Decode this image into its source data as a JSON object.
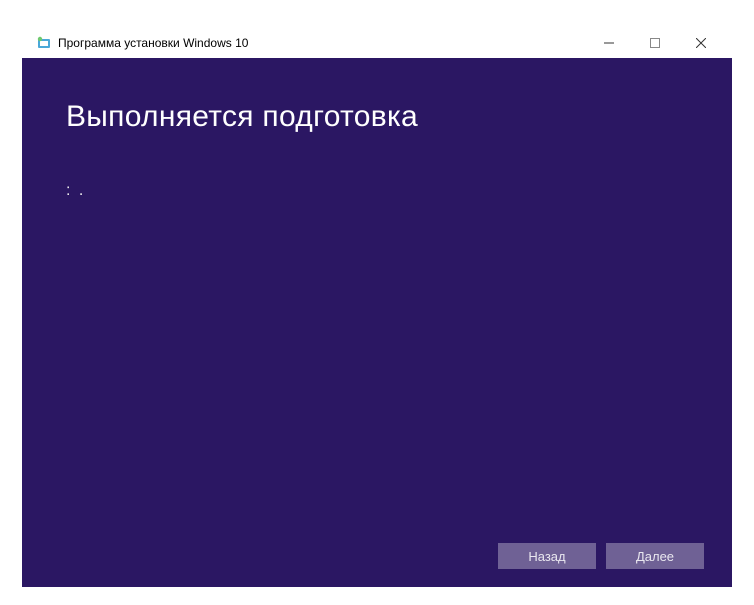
{
  "window": {
    "title": "Программа установки Windows 10"
  },
  "content": {
    "heading": "Выполняется подготовка",
    "progress": ": ."
  },
  "footer": {
    "back_label": "Назад",
    "next_label": "Далее"
  }
}
